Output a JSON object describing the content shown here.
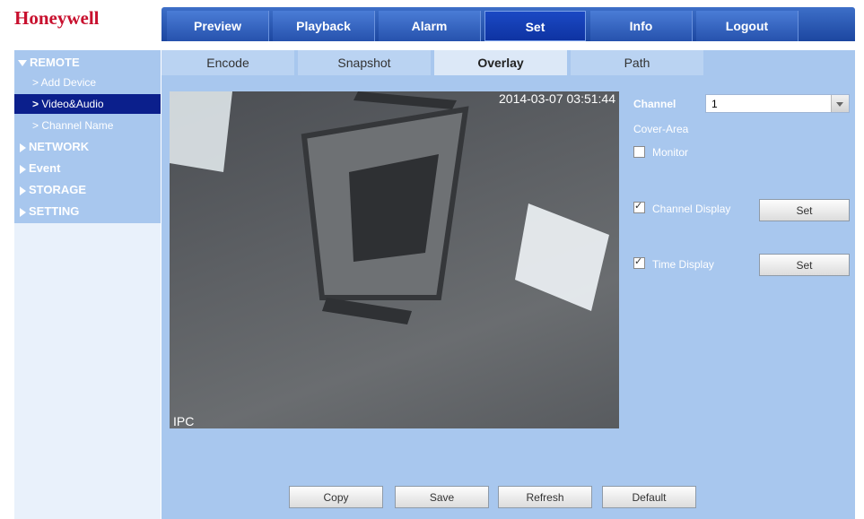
{
  "brand": "Honeywell",
  "topnav": [
    "Preview",
    "Playback",
    "Alarm",
    "Set",
    "Info",
    "Logout"
  ],
  "sidebar": {
    "remote": "REMOTE",
    "remote_sub": [
      "> Add Device",
      "Video&Audio",
      "> Channel Name"
    ],
    "network": "NETWORK",
    "event": "Event",
    "storage": "STORAGE",
    "setting": "SETTING"
  },
  "subtabs": [
    "Encode",
    "Snapshot",
    "Overlay",
    "Path"
  ],
  "preview": {
    "timestamp": "2014-03-07 03:51:44",
    "label": "IPC"
  },
  "settings": {
    "channel_label": "Channel",
    "channel_value": "1",
    "cover_area": "Cover-Area",
    "monitor": "Monitor",
    "channel_display": "Channel Display",
    "time_display": "Time Display",
    "set_label": "Set"
  },
  "buttons": [
    "Copy",
    "Save",
    "Refresh",
    "Default"
  ],
  "colors": {
    "brand": "#c8102e",
    "nav_blue": "#2652ad",
    "panel": "#a8c7ee",
    "active_sub": "#0b1f8c"
  }
}
